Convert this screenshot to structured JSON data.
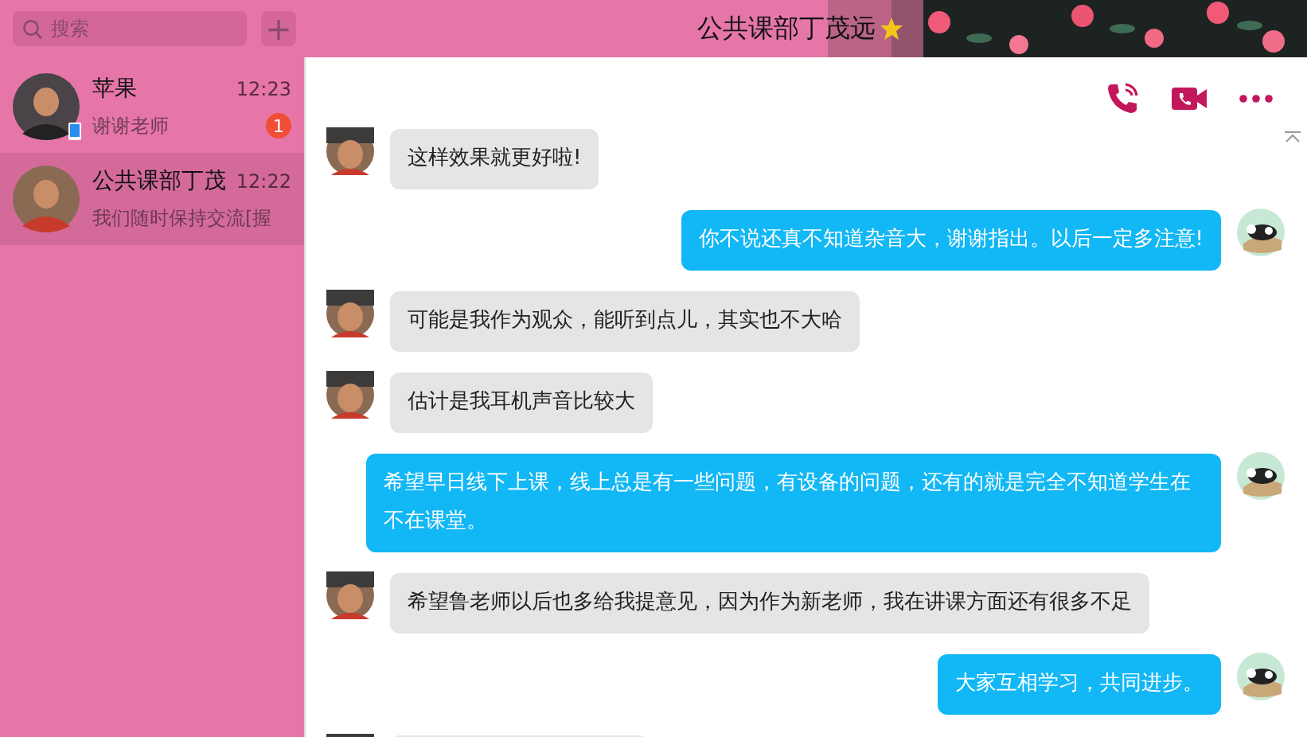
{
  "search": {
    "placeholder": "搜索"
  },
  "add_button": {
    "label": "+"
  },
  "chat_title": "公共课部丁茂远",
  "contacts": [
    {
      "name": "苹果",
      "time": "12:23",
      "preview": "谢谢老师",
      "unread": "1",
      "mobile": true,
      "selected": false
    },
    {
      "name": "公共课部丁茂",
      "time": "12:22",
      "preview": "我们随时保持交流[握",
      "mobile": false,
      "selected": true
    }
  ],
  "messages": [
    {
      "kind": "incoming",
      "text": "这样效果就更好啦!"
    },
    {
      "kind": "outgoing",
      "text": "你不说还真不知道杂音大，谢谢指出。以后一定多注意!"
    },
    {
      "kind": "incoming",
      "text": "可能是我作为观众，能听到点儿，其实也不大哈"
    },
    {
      "kind": "incoming",
      "text": "估计是我耳机声音比较大"
    },
    {
      "kind": "outgoing",
      "text": "希望早日线下上课，线上总是有一些问题，有设备的问题，还有的就是完全不知道学生在不在课堂。"
    },
    {
      "kind": "incoming",
      "text": "希望鲁老师以后也多给我提意见，因为作为新老师，我在讲课方面还有很多不足"
    },
    {
      "kind": "outgoing",
      "text": "大家互相学习，共同进步。"
    },
    {
      "kind": "incoming"
    }
  ]
}
